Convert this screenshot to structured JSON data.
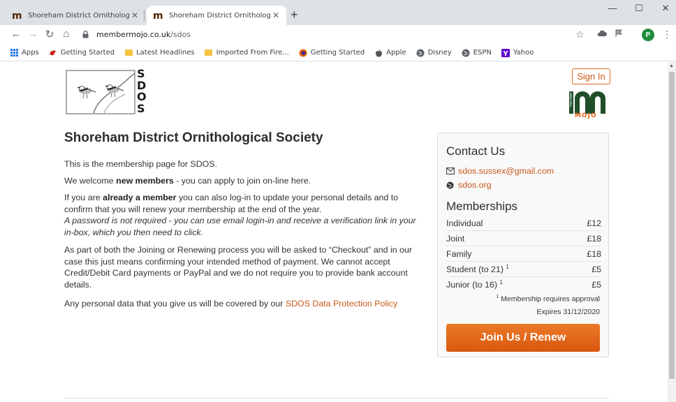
{
  "browser": {
    "tabs": [
      {
        "title": "Shoreham District Ornithological",
        "active": false
      },
      {
        "title": "Shoreham District Ornithological",
        "active": true
      }
    ],
    "url_domain": "membermojo.co.uk",
    "url_path": "/sdos",
    "profile_initial": "P",
    "bookmarks": [
      {
        "label": "Apps",
        "icon": "apps-grid-icon"
      },
      {
        "label": "Getting Started",
        "icon": "red-bird-icon"
      },
      {
        "label": "Latest Headlines",
        "icon": "folder-icon"
      },
      {
        "label": "Imported From Fire...",
        "icon": "folder-icon"
      },
      {
        "label": "Getting Started",
        "icon": "firefox-icon"
      },
      {
        "label": "Apple",
        "icon": "apple-icon"
      },
      {
        "label": "Disney",
        "icon": "globe-icon"
      },
      {
        "label": "ESPN",
        "icon": "globe-icon"
      },
      {
        "label": "Yahoo",
        "icon": "yahoo-icon"
      }
    ]
  },
  "site": {
    "logo_letters": [
      "S",
      "D",
      "O",
      "S"
    ],
    "sign_in": "Sign In",
    "mojo_text": "MOJO",
    "mojo_side": "member",
    "heading": "Shoreham District Ornithological Society",
    "intro": "This is the membership page for SDOS.",
    "welcome_pre": "We welcome ",
    "welcome_bold": "new members",
    "welcome_post": " - you can apply to join on-line here.",
    "member_pre": "If you are ",
    "member_bold": "already a member",
    "member_post": " you can also log-in to update your personal details and to confirm that you will renew your membership at the end of the year.",
    "password_note": "A password is not required - you can use email login-in and receive a verification link in your in-box, which you then need to click.",
    "checkout_text": "As part of both the Joining or Renewing process you will be asked to “Checkout” and in our case this just means confirming your intended method of payment. We cannot accept Credit/Debit Card payments or PayPal and we do not require you to provide bank account details.",
    "data_pre": "Any personal data that you give us will be covered by our ",
    "data_link": "SDOS Data Protection Policy"
  },
  "sidebar": {
    "contact_title": "Contact Us",
    "email": "sdos.sussex@gmail.com",
    "website": "sdos.org",
    "memberships_title": "Memberships",
    "memberships": [
      {
        "name": "Individual",
        "sup": "",
        "price": "£12"
      },
      {
        "name": "Joint",
        "sup": "",
        "price": "£18"
      },
      {
        "name": "Family",
        "sup": "",
        "price": "£18"
      },
      {
        "name": "Student (to 21)",
        "sup": "1",
        "price": "£5"
      },
      {
        "name": "Junior (to 16)",
        "sup": "1",
        "price": "£5"
      }
    ],
    "approval_sup": "1",
    "approval_note": " Membership requires approval",
    "expires": "Expires 31/12/2020",
    "join_button": "Join Us / Renew"
  },
  "colors": {
    "accent": "#d9560f",
    "link": "#c8581a",
    "mojo_green": "#1f4f2a"
  }
}
